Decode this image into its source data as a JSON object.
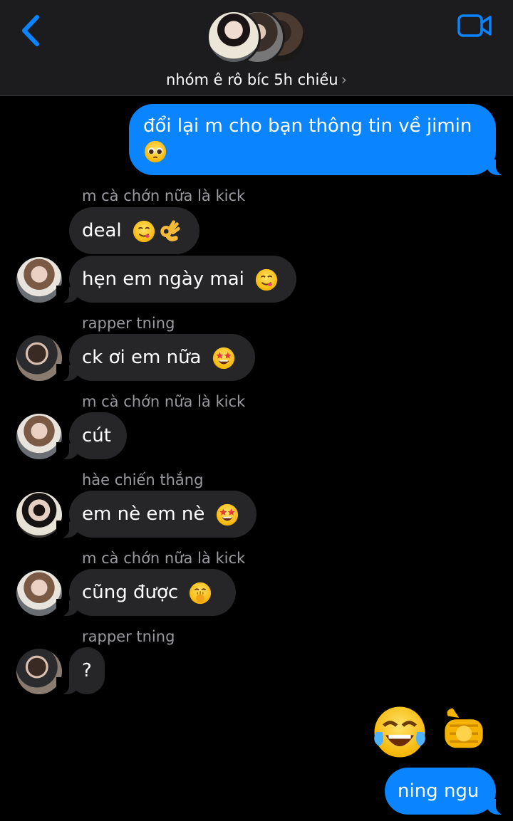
{
  "header": {
    "title": "nhóm ê rô bíc 5h chiều",
    "back_icon": "chevron-left-icon",
    "video_icon": "video-camera-icon",
    "accent": "#0a84ff"
  },
  "messages": {
    "m1": {
      "text": "đổi lại m cho bạn thông tin về jimin",
      "emoji": "pleading-face"
    },
    "m2": {
      "sender": "m cà chớn nữa là kick",
      "text": "deal",
      "emojis": [
        "yum-face",
        "ok-hand"
      ]
    },
    "m3": {
      "text": "hẹn em ngày mai",
      "emoji": "yum-face"
    },
    "m4": {
      "sender": "rapper tning",
      "text": "ck ơi em nữa",
      "emoji": "star-struck"
    },
    "m5": {
      "sender": "m cà chớn nữa là kick",
      "text": "cút"
    },
    "m6": {
      "sender": "hàe chiến thắng",
      "text": "em nè em nè",
      "emoji": "star-struck"
    },
    "m7": {
      "sender": "m cà chớn nữa là kick",
      "text": "cũng được",
      "emoji": "hand-over-mouth"
    },
    "m8": {
      "sender": "rapper tning",
      "text": "?"
    },
    "m9": {
      "big_emojis": [
        "tears-of-joy",
        "pointing-at-viewer"
      ]
    },
    "m10": {
      "text": "ning ngu"
    }
  },
  "colors": {
    "incoming_bubble": "#262628",
    "outgoing_bubble": "#0a84ff",
    "sender_name": "#9a9aa0"
  }
}
